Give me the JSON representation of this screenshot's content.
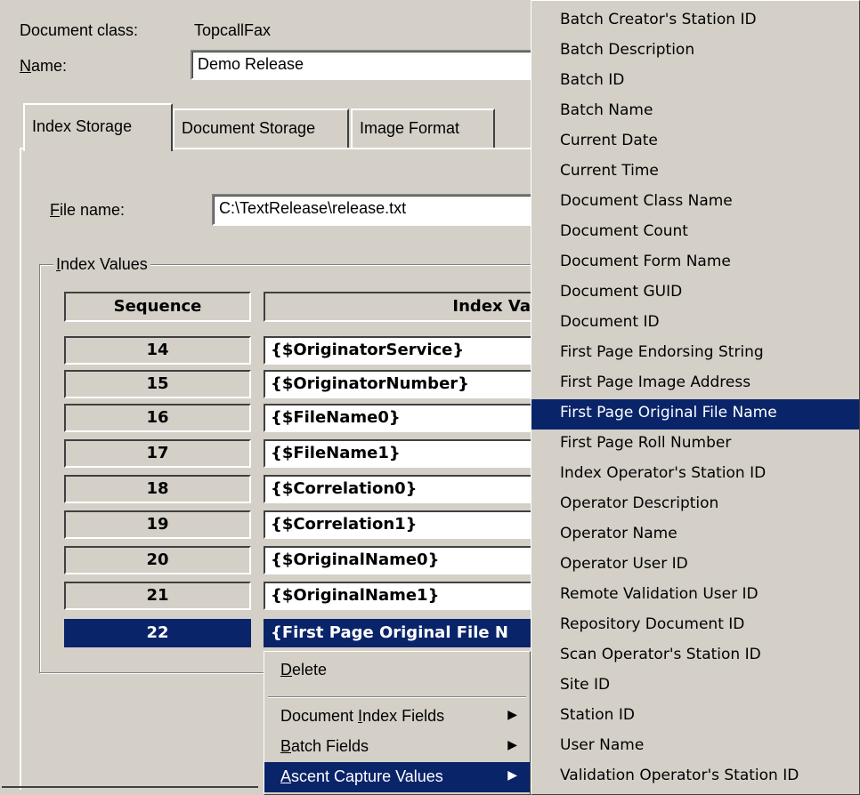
{
  "header": {
    "doc_class_label": "Document class:",
    "doc_class_value": "TopcallFax",
    "name_label_u": "N",
    "name_label_rest": "ame:",
    "name_value": "Demo Release"
  },
  "tabs": [
    {
      "label": "Index Storage"
    },
    {
      "label": "Document Storage"
    },
    {
      "label": "Image Format"
    }
  ],
  "index_storage": {
    "file_name_label_u": "F",
    "file_name_label_rest": "ile name:",
    "file_name_value": "C:\\TextRelease\\release.txt",
    "group_title_u": "I",
    "group_title_rest": "ndex Values",
    "columns": {
      "sequence": "Sequence",
      "index_value": "Index Va"
    },
    "rows": [
      {
        "seq": "14",
        "value": "{$OriginatorService}"
      },
      {
        "seq": "15",
        "value": "{$OriginatorNumber}"
      },
      {
        "seq": "16",
        "value": "{$FileName0}"
      },
      {
        "seq": "17",
        "value": "{$FileName1}"
      },
      {
        "seq": "18",
        "value": "{$Correlation0}"
      },
      {
        "seq": "19",
        "value": "{$Correlation1}"
      },
      {
        "seq": "20",
        "value": "{$OriginalName0}"
      },
      {
        "seq": "21",
        "value": "{$OriginalName1}"
      },
      {
        "seq": "22",
        "value": "{First Page Original File N"
      }
    ]
  },
  "context_menu": {
    "delete_u": "D",
    "delete_rest": "elete",
    "doc_index_pre": "Document ",
    "doc_index_u": "I",
    "doc_index_rest": "ndex Fields",
    "batch_u": "B",
    "batch_rest": "atch Fields",
    "ascent_u": "A",
    "ascent_rest": "scent Capture Values"
  },
  "submenu": [
    "Batch Creator's Station ID",
    "Batch Description",
    "Batch ID",
    "Batch Name",
    "Current Date",
    "Current Time",
    "Document Class Name",
    "Document Count",
    "Document Form Name",
    "Document GUID",
    "Document ID",
    "First Page Endorsing String",
    "First Page Image Address",
    "First Page Original File Name",
    "First Page Roll Number",
    "Index Operator's Station ID",
    "Operator Description",
    "Operator Name",
    "Operator User ID",
    "Remote Validation User ID",
    "Repository Document ID",
    "Scan Operator's Station ID",
    "Site ID",
    "Station ID",
    "User Name",
    "Validation Operator's Station ID"
  ],
  "colors": {
    "face": "#d4d0c8",
    "highlight": "#0a246a"
  },
  "icons": {
    "submenu_arrow": "triangle-right-icon"
  }
}
